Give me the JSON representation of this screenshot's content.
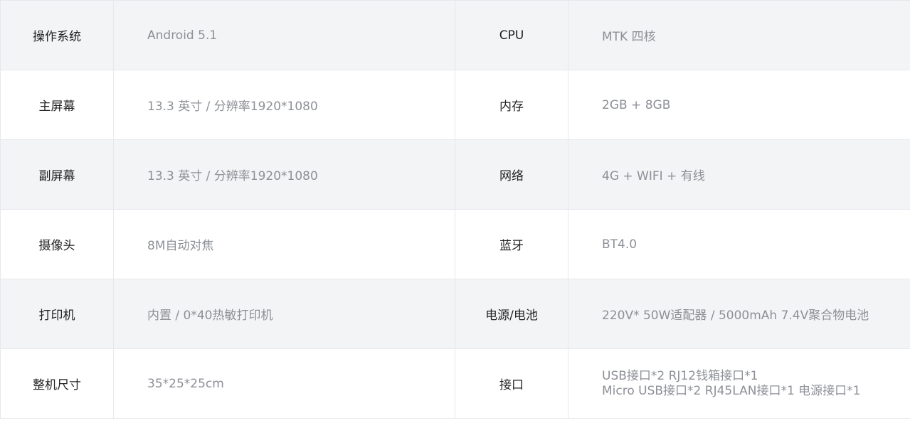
{
  "spec_rows": [
    {
      "left_label": "操作系统",
      "left_value": "Android 5.1",
      "right_label": "CPU",
      "right_value": "MTK 四核"
    },
    {
      "left_label": "主屏幕",
      "left_value": "13.3 英寸 / 分辨率1920*1080",
      "right_label": "内存",
      "right_value": "2GB + 8GB"
    },
    {
      "left_label": "副屏幕",
      "left_value": "13.3 英寸 / 分辨率1920*1080",
      "right_label": "网络",
      "right_value": "4G + WIFI + 有线"
    },
    {
      "left_label": "摄像头",
      "left_value": "8M自动对焦",
      "right_label": "蓝牙",
      "right_value": "BT4.0"
    },
    {
      "left_label": "打印机",
      "left_value": "内置 / 0*40热敏打印机",
      "right_label": "电源/电池",
      "right_value": "220V* 50W适配器 / 5000mAh 7.4V聚合物电池"
    },
    {
      "left_label": "整机尺寸",
      "left_value": "35*25*25cm",
      "right_label": "接口",
      "right_value_lines": [
        "USB接口*2 RJ12钱箱接口*1",
        "Micro USB接口*2 RJ45LAN接口*1 电源接口*1"
      ]
    }
  ],
  "colors": {
    "border": "#e6e8eb",
    "shaded_row_bg": "#f3f4f5",
    "label_text": "#222222",
    "value_text": "#8d9096"
  }
}
